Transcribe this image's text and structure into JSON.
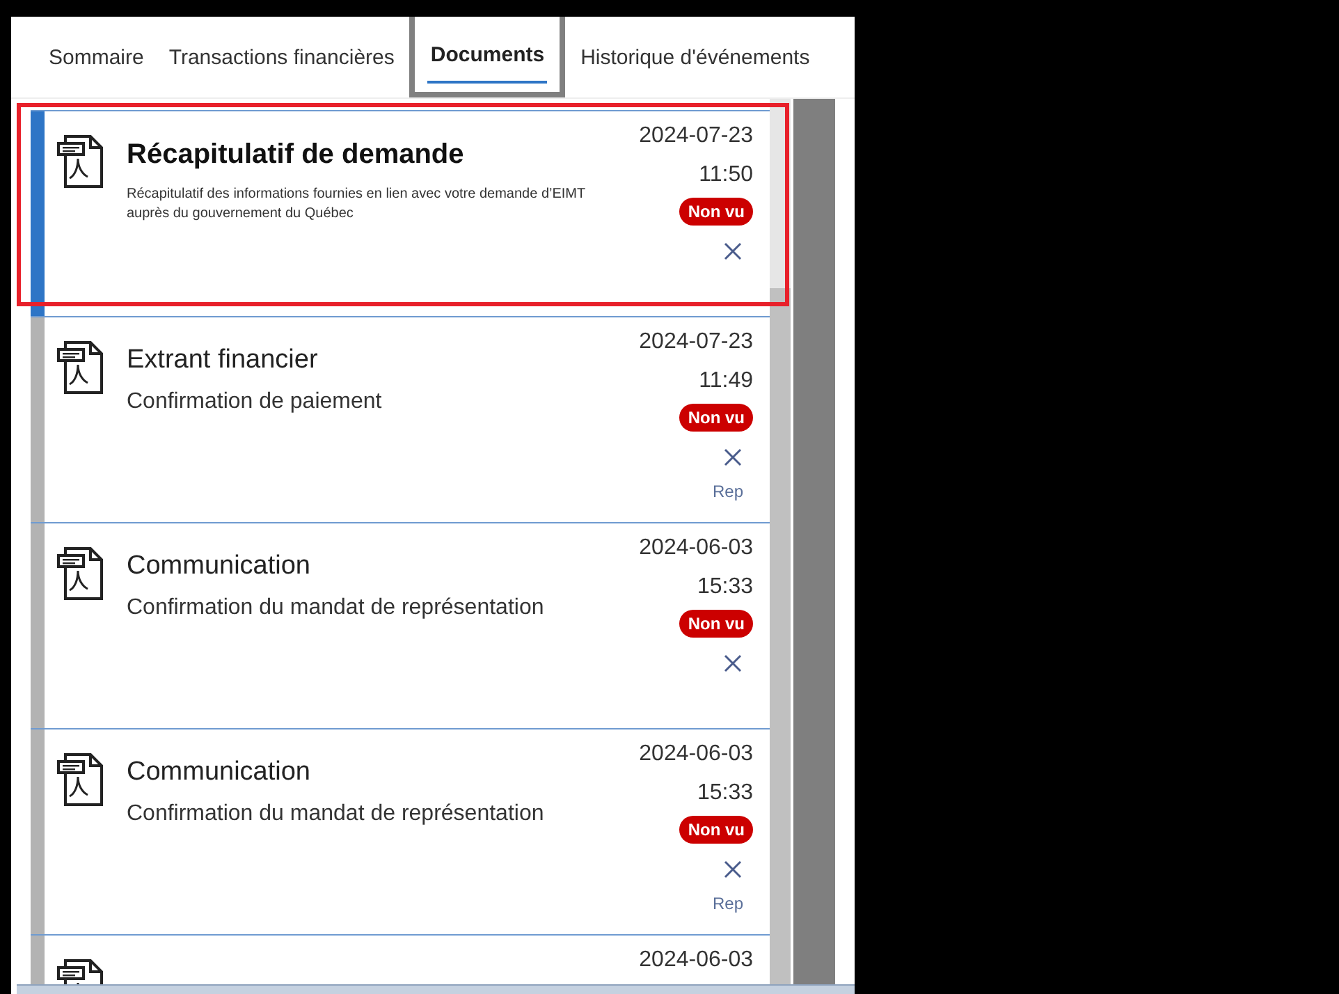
{
  "tabs": [
    {
      "label": "Sommaire",
      "selected": false,
      "outlined": false
    },
    {
      "label": "Transactions financières",
      "selected": false,
      "outlined": false
    },
    {
      "label": "Documents",
      "selected": true,
      "outlined": true
    },
    {
      "label": "Historique d'événements",
      "selected": false,
      "outlined": false
    }
  ],
  "documents": [
    {
      "kind": "summary",
      "title": "Récapitulatif de demande",
      "description": "Récapitulatif des informations fournies en lien avec votre demande d’EIMT auprès du gouvernement du Québec",
      "date": "2024-07-23",
      "time": "11:50",
      "badge": "Non vu",
      "selected": true,
      "highlighted": true
    },
    {
      "kind": "regular",
      "title": "Extrant financier",
      "description": "Confirmation de paiement",
      "date": "2024-07-23",
      "time": "11:49",
      "badge": "Non vu",
      "link": "Rep",
      "selected": false,
      "highlighted": false
    },
    {
      "kind": "regular",
      "title": "Communication",
      "description": "Confirmation du mandat de représentation",
      "date": "2024-06-03",
      "time": "15:33",
      "badge": "Non vu",
      "selected": false,
      "highlighted": false
    },
    {
      "kind": "regular",
      "title": "Communication",
      "description": "Confirmation du mandat de représentation",
      "date": "2024-06-03",
      "time": "15:33",
      "badge": "Non vu",
      "link": "Rep",
      "selected": false,
      "highlighted": false
    },
    {
      "date": "2024-06-03",
      "selected": false,
      "highlighted": false
    }
  ]
}
